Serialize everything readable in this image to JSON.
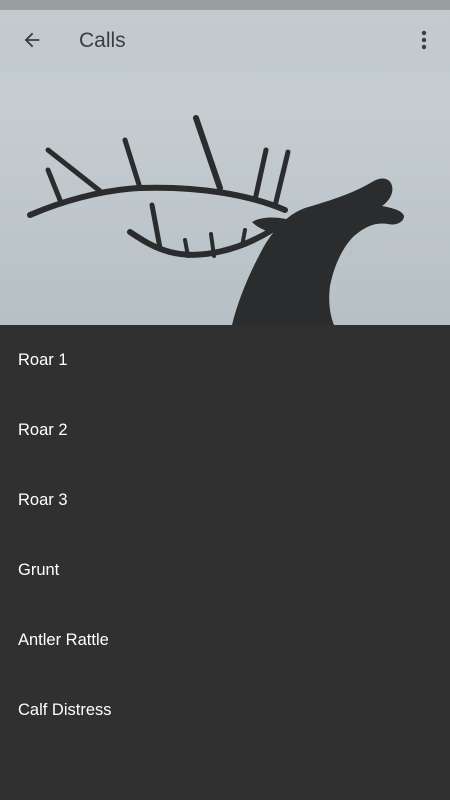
{
  "app_bar": {
    "title": "Calls",
    "back_icon": "arrow-back-icon",
    "menu_icon": "more-vert-icon"
  },
  "hero": {
    "subject": "elk-silhouette"
  },
  "calls": [
    {
      "label": "Roar 1"
    },
    {
      "label": "Roar 2"
    },
    {
      "label": "Roar 3"
    },
    {
      "label": "Grunt"
    },
    {
      "label": "Antler Rattle"
    },
    {
      "label": "Calf Distress"
    }
  ],
  "colors": {
    "list_background": "#303030",
    "list_text": "#ffffff",
    "sky": "#c3cbcf",
    "silhouette": "#2a2c2e"
  }
}
